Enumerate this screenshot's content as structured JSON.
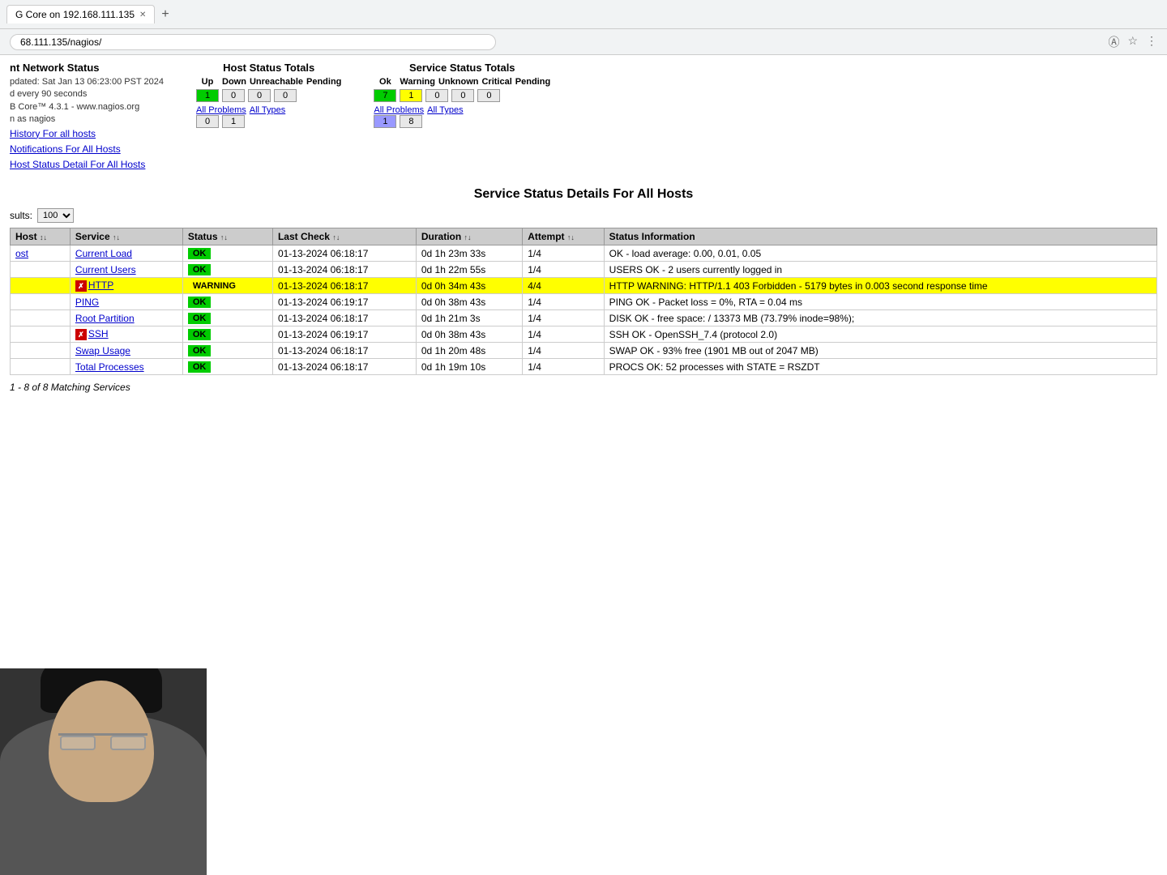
{
  "browser": {
    "tab_title": "G Core on 192.168.111.135",
    "url": "68.111.135/nagios/",
    "new_tab_symbol": "+"
  },
  "network_status": {
    "title": "nt Network Status",
    "updated": "pdated: Sat Jan 13 06:23:00 PST 2024",
    "interval": "d every 90 seconds",
    "version": "B Core™ 4.3.1 - www.nagios.org",
    "nagios": "n as nagios"
  },
  "host_status": {
    "title": "Host Status Totals",
    "headers": [
      "Up",
      "Down",
      "Unreachable",
      "Pending"
    ],
    "values": [
      "1",
      "0",
      "0",
      "0"
    ],
    "all_problems_label": "All Problems",
    "all_types_label": "All Types",
    "all_problems_value": "0",
    "all_types_value": "1"
  },
  "service_status": {
    "title": "Service Status Totals",
    "headers": [
      "Ok",
      "Warning",
      "Unknown",
      "Critical",
      "Pending"
    ],
    "values": [
      "7",
      "1",
      "0",
      "0",
      "0"
    ],
    "all_problems_label": "All Problems",
    "all_types_label": "All Types",
    "all_problems_value": "1",
    "all_types_value": "8"
  },
  "nav_links": [
    "History For all hosts",
    "Notifications For All Hosts",
    "Host Status Detail For All Hosts"
  ],
  "main_title": "Service Status Details For All Hosts",
  "results_label": "sults:",
  "results_value": "100",
  "table": {
    "columns": [
      "Host ↕",
      "Service ↕↕",
      "Status ↕↕",
      "Last Check ↕↕",
      "Duration ↕↕",
      "Attempt ↕↕",
      "Status Information"
    ],
    "rows": [
      {
        "host": "ost",
        "service": "Current Load",
        "status": "OK",
        "status_type": "ok",
        "last_check": "01-13-2024 06:18:17",
        "duration": "0d 1h 23m 33s",
        "attempt": "1/4",
        "info": "OK - load average: 0.00, 0.01, 0.05",
        "has_icon": false,
        "warning_icon": false
      },
      {
        "host": "",
        "service": "Current Users",
        "status": "OK",
        "status_type": "ok",
        "last_check": "01-13-2024 06:18:17",
        "duration": "0d 1h 22m 55s",
        "attempt": "1/4",
        "info": "USERS OK - 2 users currently logged in",
        "has_icon": false,
        "warning_icon": false
      },
      {
        "host": "",
        "service": "HTTP",
        "status": "WARNING",
        "status_type": "warning",
        "last_check": "01-13-2024 06:18:17",
        "duration": "0d 0h 34m 43s",
        "attempt": "4/4",
        "info": "HTTP WARNING: HTTP/1.1 403 Forbidden - 5179 bytes in 0.003 second response time",
        "has_icon": true,
        "warning_icon": true
      },
      {
        "host": "",
        "service": "PING",
        "status": "OK",
        "status_type": "ok",
        "last_check": "01-13-2024 06:19:17",
        "duration": "0d 0h 38m 43s",
        "attempt": "1/4",
        "info": "PING OK - Packet loss = 0%, RTA = 0.04 ms",
        "has_icon": false,
        "warning_icon": false
      },
      {
        "host": "",
        "service": "Root Partition",
        "status": "OK",
        "status_type": "ok",
        "last_check": "01-13-2024 06:18:17",
        "duration": "0d 1h 21m 3s",
        "attempt": "1/4",
        "info": "DISK OK - free space: / 13373 MB (73.79% inode=98%);",
        "has_icon": false,
        "warning_icon": false
      },
      {
        "host": "",
        "service": "SSH",
        "status": "OK",
        "status_type": "ok",
        "last_check": "01-13-2024 06:19:17",
        "duration": "0d 0h 38m 43s",
        "attempt": "1/4",
        "info": "SSH OK - OpenSSH_7.4 (protocol 2.0)",
        "has_icon": true,
        "warning_icon": false
      },
      {
        "host": "",
        "service": "Swap Usage",
        "status": "OK",
        "status_type": "ok",
        "last_check": "01-13-2024 06:18:17",
        "duration": "0d 1h 20m 48s",
        "attempt": "1/4",
        "info": "SWAP OK - 93% free (1901 MB out of 2047 MB)",
        "has_icon": false,
        "warning_icon": false
      },
      {
        "host": "",
        "service": "Total Processes",
        "status": "OK",
        "status_type": "ok",
        "last_check": "01-13-2024 06:18:17",
        "duration": "0d 1h 19m 10s",
        "attempt": "1/4",
        "info": "PROCS OK: 52 processes with STATE = RSZDT",
        "has_icon": false,
        "warning_icon": false
      }
    ]
  },
  "matching_services": "1 - 8 of 8 Matching Services"
}
